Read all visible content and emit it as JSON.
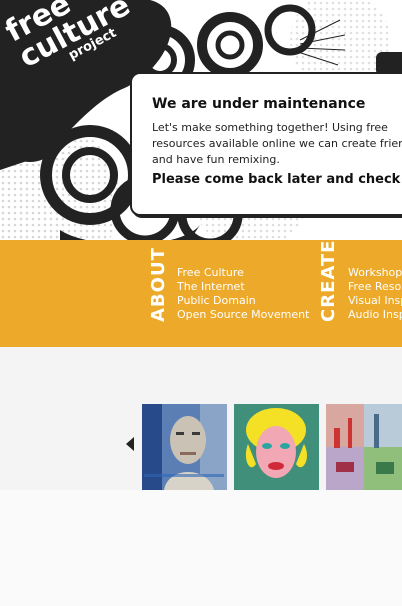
{
  "logo": {
    "line1": "free",
    "line2": "culture",
    "line3": "project"
  },
  "notice": {
    "title": "We are under maintenance",
    "body": "Let's make something together! Using free resources available online we can create friends and have fun remixing.",
    "cta": "Please come back later and check it out."
  },
  "nav": {
    "about": {
      "label": "ABOUT",
      "items": [
        "Free Culture",
        "The Internet",
        "Public Domain",
        "Open Source Movement"
      ]
    },
    "create": {
      "label": "CREATE",
      "items": [
        "Workshops",
        "Free Resou",
        "Visual Insp",
        "Audio Insp"
      ]
    }
  },
  "colors": {
    "accent": "#eda929",
    "dark": "#222222"
  },
  "gallery": {
    "icons": [
      "previous-arrow-icon"
    ]
  }
}
